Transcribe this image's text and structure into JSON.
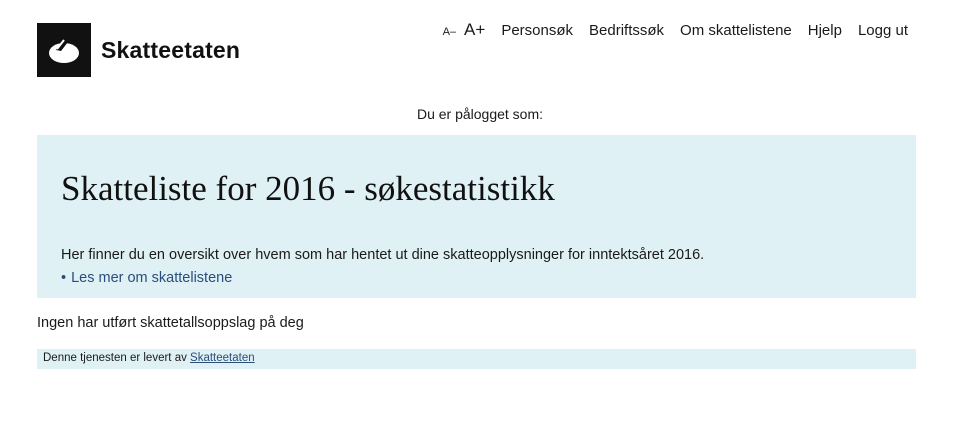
{
  "header": {
    "logo_text": "Skatteetaten",
    "nav": {
      "font_smaller": "A–",
      "font_larger": "A+",
      "items": [
        "Personsøk",
        "Bedriftssøk",
        "Om skattelistene",
        "Hjelp",
        "Logg ut"
      ]
    }
  },
  "session": {
    "logged_in_text": "Du er pålogget som:"
  },
  "panel": {
    "title": "Skatteliste for 2016 - søkestatistikk",
    "description": "Her finner du en oversikt over hvem som har hentet ut dine skatteopplysninger for inntektsåret 2016.",
    "link_bullet": "•",
    "link_label": "Les mer om skattelistene"
  },
  "result": {
    "message": "Ingen har utført skattetallsoppslag på deg"
  },
  "footer": {
    "text": "Denne tjenesten er levert av",
    "link_label": "Skatteetaten"
  },
  "colors": {
    "panel_bg": "#dff1f4",
    "link": "#2a4d7a",
    "logo_bg": "#111111"
  }
}
